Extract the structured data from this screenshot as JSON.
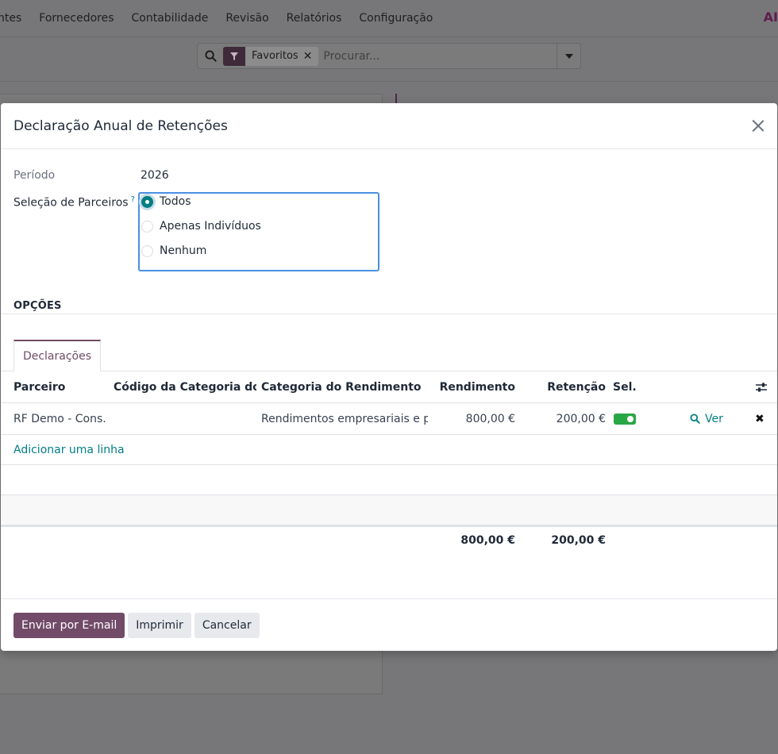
{
  "topbar": {
    "menu": [
      "ntes",
      "Fornecedores",
      "Contabilidade",
      "Revisão",
      "Relatórios",
      "Configuração"
    ],
    "logo_a": "A",
    "logo_i": "I"
  },
  "search": {
    "facet_label": "Favoritos",
    "facet_remove": "✕",
    "placeholder": "Procurar..."
  },
  "modal": {
    "title": "Declaração Anual de Retenções",
    "periodo_label": "Período",
    "periodo_value": "2026",
    "parceiros_label": "Seleção de Parceiros",
    "parceiros_help": "?",
    "options": [
      {
        "label": "Todos",
        "checked": true
      },
      {
        "label": "Apenas Indivíduos",
        "checked": false
      },
      {
        "label": "Nenhum",
        "checked": false
      }
    ],
    "section_title": "OPÇÕES",
    "tab_label": "Declarações"
  },
  "table": {
    "headers": {
      "parceiro": "Parceiro",
      "codigo": "Código da Categoria do R...",
      "categoria": "Categoria do Rendimento",
      "rendimento": "Rendimento",
      "retencao": "Retenção",
      "sel": "Sel."
    },
    "rows": [
      {
        "parceiro": "RF Demo - Cons...",
        "codigo": "",
        "categoria": "Rendimentos empresariais e p...",
        "rendimento": "800,00 €",
        "retencao": "200,00 €",
        "sel": true,
        "ver_label": "Ver",
        "delete": "✖"
      }
    ],
    "add_line": "Adicionar uma linha",
    "totals": {
      "rendimento": "800,00 €",
      "retencao": "200,00 €"
    }
  },
  "footer": {
    "email_button": "Enviar por E-mail",
    "print_button": "Imprimir",
    "cancel_button": "Cancelar"
  },
  "colors": {
    "primary": "#714b67",
    "link": "#017e84",
    "toggle_on": "#28a745",
    "focus_border": "#4a90e2"
  }
}
